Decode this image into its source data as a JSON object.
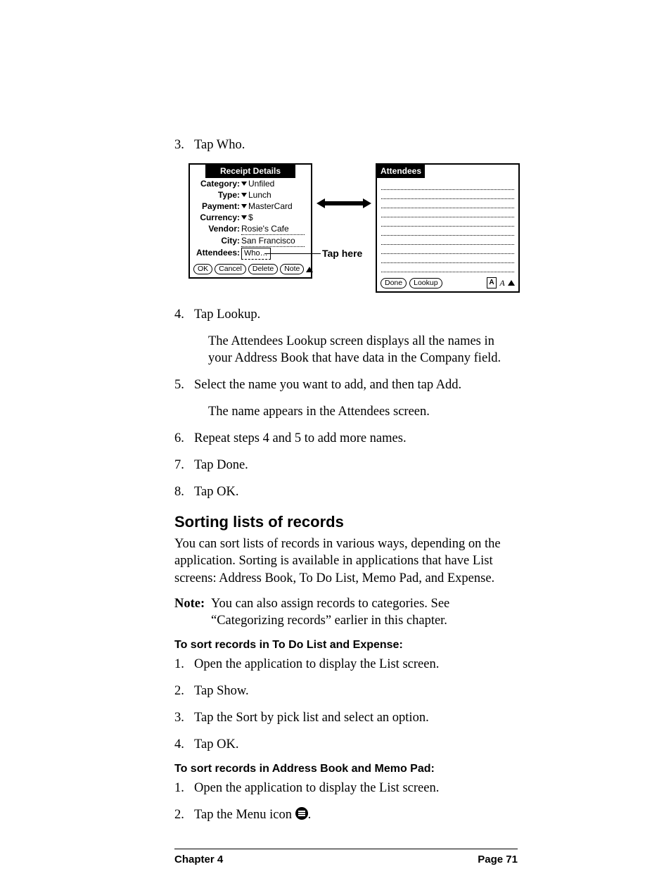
{
  "steps_a": {
    "s3": {
      "num": "3.",
      "text": "Tap Who."
    },
    "s4": {
      "num": "4.",
      "text": "Tap Lookup.",
      "sub": "The Attendees Lookup screen displays all the names in your Address Book that have data in the Company field."
    },
    "s5": {
      "num": "5.",
      "text": "Select the name you want to add, and then tap Add.",
      "sub": "The name appears in the Attendees screen."
    },
    "s6": {
      "num": "6.",
      "text": "Repeat steps 4 and 5 to add more names."
    },
    "s7": {
      "num": "7.",
      "text": "Tap Done."
    },
    "s8": {
      "num": "8.",
      "text": "Tap OK."
    }
  },
  "heading": "Sorting lists of records",
  "para1": "You can sort lists of records in various ways, depending on the application. Sorting is available in applications that have List screens: Address Book, To Do List, Memo Pad, and Expense.",
  "note": {
    "label": "Note:",
    "text": "You can also assign records to categories. See “Categorizing records” earlier in this chapter."
  },
  "sub1": {
    "title": "To sort records in To Do List and Expense:",
    "s1": {
      "num": "1.",
      "text": "Open the application to display the List screen."
    },
    "s2": {
      "num": "2.",
      "text": "Tap Show."
    },
    "s3": {
      "num": "3.",
      "text": "Tap the Sort by pick list and select an option."
    },
    "s4": {
      "num": "4.",
      "text": "Tap OK."
    }
  },
  "sub2": {
    "title": "To sort records in Address Book and Memo Pad:",
    "s1": {
      "num": "1.",
      "text": "Open the application to display the List screen."
    },
    "s2": {
      "num": "2.",
      "text_a": "Tap the Menu icon ",
      "text_b": "."
    }
  },
  "figure": {
    "left_title": "Receipt Details",
    "rows": {
      "category": {
        "label": "Category:",
        "value": "Unfiled"
      },
      "type": {
        "label": "Type:",
        "value": "Lunch"
      },
      "payment": {
        "label": "Payment:",
        "value": "MasterCard"
      },
      "currency": {
        "label": "Currency:",
        "value": "$"
      },
      "vendor": {
        "label": "Vendor:",
        "value": "Rosie's Cafe"
      },
      "city": {
        "label": "City:",
        "value": "San Francisco"
      },
      "attendees": {
        "label": "Attendees:",
        "value": "Who…"
      }
    },
    "buttons_left": {
      "ok": "OK",
      "cancel": "Cancel",
      "delete": "Delete",
      "note": "Note"
    },
    "tap_label": "Tap here",
    "right_title": "Attendees",
    "buttons_right": {
      "done": "Done",
      "lookup": "Lookup"
    },
    "glyph": "A"
  },
  "footer": {
    "left": "Chapter 4",
    "right": "Page 71"
  }
}
